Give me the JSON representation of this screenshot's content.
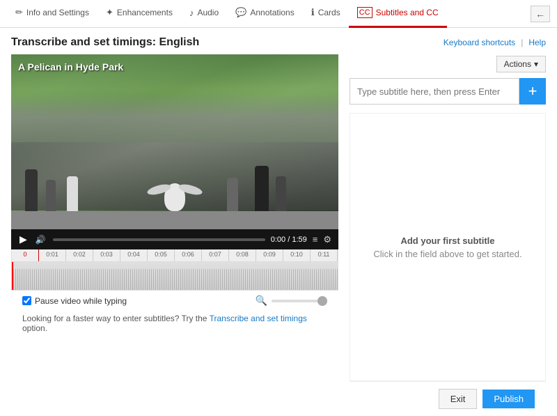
{
  "nav": {
    "tabs": [
      {
        "id": "info",
        "label": "Info and Settings",
        "icon": "✏",
        "active": false
      },
      {
        "id": "enhancements",
        "label": "Enhancements",
        "icon": "✦",
        "active": false
      },
      {
        "id": "audio",
        "label": "Audio",
        "icon": "♪",
        "active": false
      },
      {
        "id": "annotations",
        "label": "Annotations",
        "icon": "💬",
        "active": false
      },
      {
        "id": "cards",
        "label": "Cards",
        "icon": "ℹ",
        "active": false
      },
      {
        "id": "subtitles",
        "label": "Subtitles and CC",
        "icon": "CC",
        "active": true
      }
    ],
    "back_button": "←"
  },
  "page": {
    "title": "Transcribe and set timings: English",
    "keyboard_shortcuts": "Keyboard shortcuts",
    "divider": "|",
    "help": "Help"
  },
  "video": {
    "title": "A Pelican in Hyde Park",
    "time": "0:00 / 1:59",
    "play_icon": "▶",
    "volume_icon": "🔊",
    "captions_icon": "≡",
    "settings_icon": "⚙"
  },
  "timeline": {
    "ticks": [
      "0:01",
      "0:02",
      "0:03",
      "0:04",
      "0:05",
      "0:06",
      "0:07",
      "0:08",
      "0:09",
      "0:10",
      "0:11"
    ]
  },
  "controls": {
    "pause_label": "Pause video while typing",
    "checkbox_checked": true
  },
  "subtitle_panel": {
    "actions_label": "Actions",
    "input_placeholder": "Type subtitle here, then press Enter",
    "add_button": "+",
    "empty_state_title": "Add your first subtitle",
    "empty_state_hint": "Click in the field above to get started."
  },
  "footer": {
    "hint_text": "Looking for a faster way to enter subtitles? Try the",
    "link_text": "Transcribe and set timings",
    "hint_suffix": "option.",
    "exit_label": "Exit",
    "publish_label": "Publish"
  }
}
